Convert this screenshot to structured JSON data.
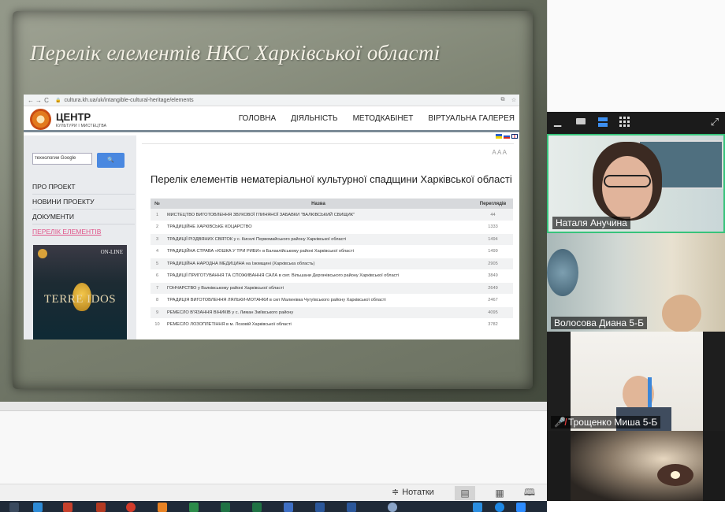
{
  "slide": {
    "title": "Перелік елементів НКС Харківської області"
  },
  "browser": {
    "url": "cultura.kh.ua/uk/intangible-cultural-heritage/elements",
    "nav_back": "←",
    "nav_forward": "→",
    "nav_reload": "C"
  },
  "site": {
    "logo_title": "ЦЕНТР",
    "logo_subtitle": "КУЛЬТУРИ І МИСТЕЦТВА",
    "nav": [
      "ГОЛОВНА",
      "ДІЯЛЬНІСТЬ",
      "МЕТОДКАБІНЕТ",
      "ВІРТУАЛЬНА ГАЛЕРЕЯ"
    ],
    "search_value": "технологии Google",
    "search_button": "🔍",
    "sidebar": [
      "ПРО ПРОЕКТ",
      "НОВИНИ ПРОЕКТУ",
      "ДОКУМЕНТИ",
      "ПЕРЕЛІК ЕЛЕМЕНТІВ"
    ],
    "poster_online": "ON-LINE",
    "poster_title": "TERRE  IDOS",
    "font_size_control": "A A A",
    "content_title": "Перелік елементів нематеріальної культурної спадщини Харківської області",
    "table": {
      "headers": [
        "№",
        "Назва",
        "Переглядів"
      ],
      "rows": [
        {
          "num": "1",
          "name": "МИСТЕЦТВО ВИГОТОВЛЕННЯ ЗВУКОВОЇ ГЛИНЯНОЇ ЗАБАВКИ \"ВАЛКІВСЬКИЙ СВИЩИК\"",
          "views": "44"
        },
        {
          "num": "2",
          "name": "ТРАДИЦІЙНЕ ХАРКІВСЬКЕ КОЦАРСТВО",
          "views": "1333"
        },
        {
          "num": "3",
          "name": "ТРАДИЦІЇ РІЗДВЯНИХ СВЯТОК у с. Киселі Первомайського району Харківської області",
          "views": "1494"
        },
        {
          "num": "4",
          "name": "ТРАДИЦІЙНА СТРАВА «ЮШКА У ТРИ РИБИ» в Балаклійському районі Харківської області",
          "views": "1499"
        },
        {
          "num": "5",
          "name": "ТРАДИЦІЙНА НАРОДНА МЕДИЦИНА на Ізюмщині (Харківська область)",
          "views": "2905"
        },
        {
          "num": "6",
          "name": "ТРАДИЦІЇ ПРИГОТУВАННЯ ТА СПОЖИВАННЯ САЛА в смт. Вільшани Дергачівського району Харківської області",
          "views": "3849"
        },
        {
          "num": "7",
          "name": "ГОНЧАРСТВО у Валківському районі Харківської області",
          "views": "2649"
        },
        {
          "num": "8",
          "name": "ТРАДИЦІЯ ВИГОТОВЛЕННЯ ЛЯЛЬКИ-МОТАНКИ в смт Малинівка Чугуївського району Харківської області",
          "views": "2467"
        },
        {
          "num": "9",
          "name": "РЕМЕСЛО В'ЯЗАННЯ ВІНИКІВ у с. Лиман Зміївського району",
          "views": "4095"
        },
        {
          "num": "10",
          "name": "РЕМЕСЛО ЛОЗОПЛЕТІННЯ в м. Лозовій Харківської області",
          "views": "3782"
        }
      ]
    }
  },
  "presentation": {
    "notes_label": "Нотатки"
  },
  "zoom": {
    "participants": [
      {
        "name": "Наталя Анучина",
        "muted": false,
        "active_speaker": true
      },
      {
        "name": "Волосова Диана 5-Б",
        "muted": false,
        "active_speaker": false
      },
      {
        "name": "Трощенко Миша 5-Б",
        "muted": true,
        "active_speaker": false
      },
      {
        "name": "",
        "muted": false,
        "active_speaker": false
      }
    ]
  },
  "colors": {
    "active_speaker_border": "#37c37b",
    "sidebar_active": "#e0558a",
    "search_button": "#4a88e0",
    "taskbar": "#1f2a38"
  }
}
